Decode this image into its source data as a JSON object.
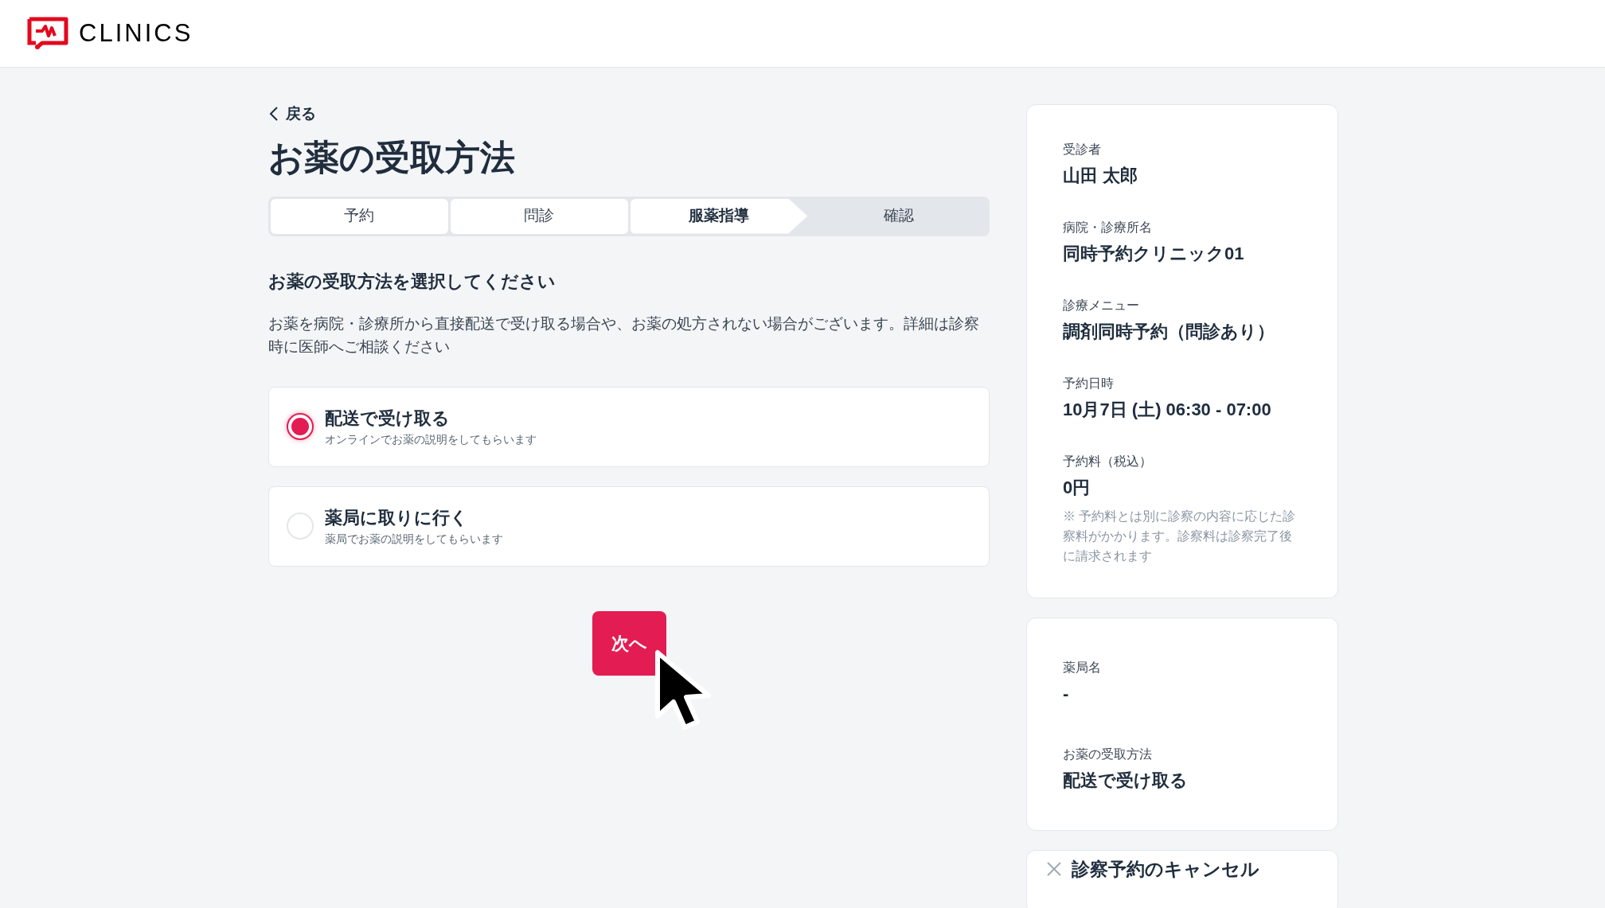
{
  "header": {
    "logo_text": "CLINICS"
  },
  "back_link": "戻る",
  "title": "お薬の受取方法",
  "steps": [
    {
      "label": "予約",
      "completed": true,
      "selected": false
    },
    {
      "label": "問診",
      "completed": true,
      "selected": false
    },
    {
      "label": "服薬指導",
      "completed": false,
      "selected": true
    },
    {
      "label": "確認",
      "completed": false,
      "selected": false
    }
  ],
  "section_heading": "お薬の受取方法を選択してください",
  "description": "お薬を病院・診療所から直接配送で受け取る場合や、お薬の処方されない場合がございます。詳細は診察時に医師へご相談ください",
  "options": [
    {
      "title": "配送で受け取る",
      "subtitle": "オンラインでお薬の説明をしてもらいます",
      "selected": true
    },
    {
      "title": "薬局に取りに行く",
      "subtitle": "薬局でお薬の説明をしてもらいます",
      "selected": false
    }
  ],
  "next_button": "次へ",
  "summary": {
    "items": [
      {
        "label": "受診者",
        "value": "山田 太郎"
      },
      {
        "label": "病院・診療所名",
        "value": "同時予約クリニック01"
      },
      {
        "label": "診療メニュー",
        "value": "調剤同時予約（問診あり）"
      },
      {
        "label": "予約日時",
        "value": "10月7日 (土) 06:30 - 07:00"
      },
      {
        "label": "予約料（税込）",
        "value": "0円"
      }
    ],
    "note": "※ 予約料とは別に診察の内容に応じた診察料がかかります。診察料は診察完了後に請求されます"
  },
  "pharmacy": {
    "items": [
      {
        "label": "薬局名",
        "value": "-"
      },
      {
        "label": "お薬の受取方法",
        "value": "配送で受け取る"
      }
    ]
  },
  "cancel_link": "診察予約のキャンセル"
}
